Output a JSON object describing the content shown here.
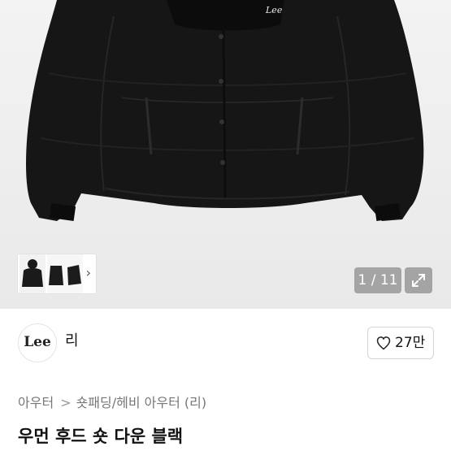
{
  "gallery": {
    "logo_text": "Lee",
    "counter": "1 / 11",
    "current_image": 1,
    "total_images": 11,
    "thumbnail_count": 3
  },
  "brand": {
    "logo_text": "Lee",
    "name": "리"
  },
  "like": {
    "count": "27만"
  },
  "breadcrumb": {
    "items": [
      "아우터",
      "숏패딩/헤비 아우터 (리)"
    ],
    "separator": ">"
  },
  "product": {
    "title": "우먼 후드 숏 다운 블랙"
  },
  "icons": {
    "thumb_chevron": "chevron-right-icon",
    "expand": "expand-icon",
    "like": "heart-icon",
    "breadcrumb_separator": "chevron-right-icon"
  },
  "colors": {
    "product": "#141414",
    "hero_background": "#efefef",
    "counter_background": "#8c8c8c"
  }
}
